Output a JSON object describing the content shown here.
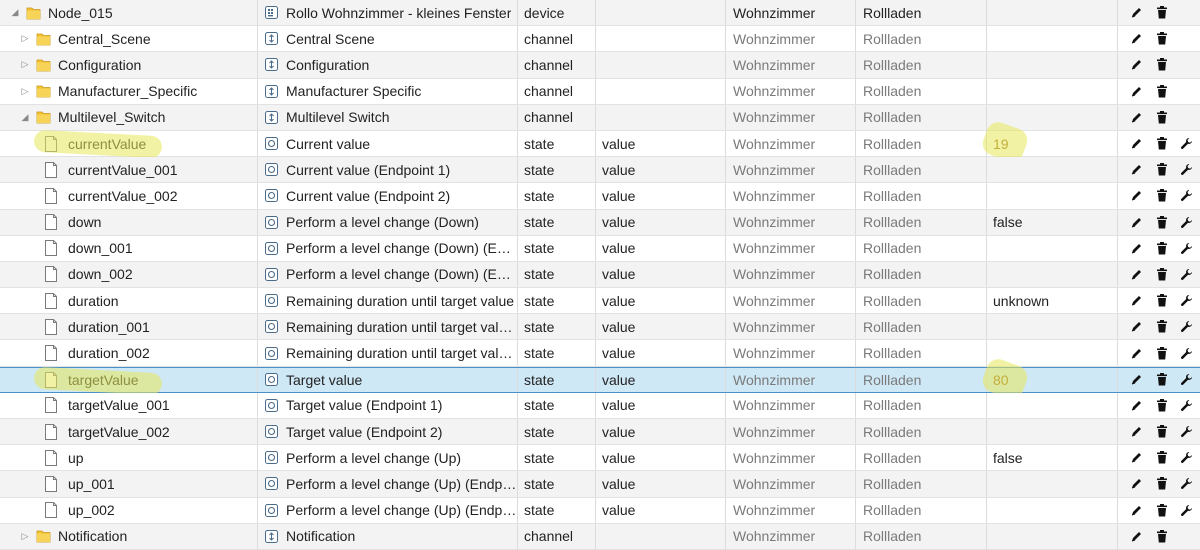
{
  "rows": [
    {
      "name": "Node_015",
      "desc": "Rollo Wohnzimmer - kleines Fenster",
      "type": "device",
      "role": "",
      "room": "Wohnzimmer",
      "func": "Rollladen",
      "value": ""
    },
    {
      "name": "Central_Scene",
      "desc": "Central Scene",
      "type": "channel",
      "role": "",
      "room": "Wohnzimmer",
      "func": "Rollladen",
      "value": ""
    },
    {
      "name": "Configuration",
      "desc": "Configuration",
      "type": "channel",
      "role": "",
      "room": "Wohnzimmer",
      "func": "Rollladen",
      "value": ""
    },
    {
      "name": "Manufacturer_Specific",
      "desc": "Manufacturer Specific",
      "type": "channel",
      "role": "",
      "room": "Wohnzimmer",
      "func": "Rollladen",
      "value": ""
    },
    {
      "name": "Multilevel_Switch",
      "desc": "Multilevel Switch",
      "type": "channel",
      "role": "",
      "room": "Wohnzimmer",
      "func": "Rollladen",
      "value": ""
    },
    {
      "name": "currentValue",
      "desc": "Current value",
      "type": "state",
      "role": "value",
      "room": "Wohnzimmer",
      "func": "Rollladen",
      "value": "19"
    },
    {
      "name": "currentValue_001",
      "desc": "Current value (Endpoint 1)",
      "type": "state",
      "role": "value",
      "room": "Wohnzimmer",
      "func": "Rollladen",
      "value": ""
    },
    {
      "name": "currentValue_002",
      "desc": "Current value (Endpoint 2)",
      "type": "state",
      "role": "value",
      "room": "Wohnzimmer",
      "func": "Rollladen",
      "value": ""
    },
    {
      "name": "down",
      "desc": "Perform a level change (Down)",
      "type": "state",
      "role": "value",
      "room": "Wohnzimmer",
      "func": "Rollladen",
      "value": "false"
    },
    {
      "name": "down_001",
      "desc": "Perform a level change (Down) (End...",
      "type": "state",
      "role": "value",
      "room": "Wohnzimmer",
      "func": "Rollladen",
      "value": ""
    },
    {
      "name": "down_002",
      "desc": "Perform a level change (Down) (End...",
      "type": "state",
      "role": "value",
      "room": "Wohnzimmer",
      "func": "Rollladen",
      "value": ""
    },
    {
      "name": "duration",
      "desc": "Remaining duration until target value",
      "type": "state",
      "role": "value",
      "room": "Wohnzimmer",
      "func": "Rollladen",
      "value": "unknown"
    },
    {
      "name": "duration_001",
      "desc": "Remaining duration until target valu...",
      "type": "state",
      "role": "value",
      "room": "Wohnzimmer",
      "func": "Rollladen",
      "value": ""
    },
    {
      "name": "duration_002",
      "desc": "Remaining duration until target valu...",
      "type": "state",
      "role": "value",
      "room": "Wohnzimmer",
      "func": "Rollladen",
      "value": ""
    },
    {
      "name": "targetValue",
      "desc": "Target value",
      "type": "state",
      "role": "value",
      "room": "Wohnzimmer",
      "func": "Rollladen",
      "value": "80"
    },
    {
      "name": "targetValue_001",
      "desc": "Target value (Endpoint 1)",
      "type": "state",
      "role": "value",
      "room": "Wohnzimmer",
      "func": "Rollladen",
      "value": ""
    },
    {
      "name": "targetValue_002",
      "desc": "Target value (Endpoint 2)",
      "type": "state",
      "role": "value",
      "room": "Wohnzimmer",
      "func": "Rollladen",
      "value": ""
    },
    {
      "name": "up",
      "desc": "Perform a level change (Up)",
      "type": "state",
      "role": "value",
      "room": "Wohnzimmer",
      "func": "Rollladen",
      "value": "false"
    },
    {
      "name": "up_001",
      "desc": "Perform a level change (Up) (Endpoi...",
      "type": "state",
      "role": "value",
      "room": "Wohnzimmer",
      "func": "Rollladen",
      "value": ""
    },
    {
      "name": "up_002",
      "desc": "Perform a level change (Up) (Endpoi...",
      "type": "state",
      "role": "value",
      "room": "Wohnzimmer",
      "func": "Rollladen",
      "value": ""
    },
    {
      "name": "Notification",
      "desc": "Notification",
      "type": "channel",
      "role": "",
      "room": "Wohnzimmer",
      "func": "Rollladen",
      "value": ""
    }
  ],
  "row_meta": [
    {
      "kind": "device",
      "expanded": true,
      "icon": "folder-icon",
      "desc_icon": "device-icon",
      "actions": [
        "edit-icon",
        "delete-icon"
      ]
    },
    {
      "kind": "channel",
      "expanded": false,
      "icon": "folder-icon",
      "desc_icon": "channel-icon",
      "actions": [
        "edit-icon",
        "delete-icon"
      ]
    },
    {
      "kind": "channel",
      "expanded": false,
      "icon": "folder-icon",
      "desc_icon": "channel-icon",
      "actions": [
        "edit-icon",
        "delete-icon"
      ]
    },
    {
      "kind": "channel",
      "expanded": false,
      "icon": "folder-icon",
      "desc_icon": "channel-icon",
      "actions": [
        "edit-icon",
        "delete-icon"
      ]
    },
    {
      "kind": "channel",
      "expanded": true,
      "icon": "folder-icon",
      "desc_icon": "channel-icon",
      "actions": [
        "edit-icon",
        "delete-icon"
      ]
    },
    {
      "kind": "state",
      "icon": "file-icon",
      "desc_icon": "state-icon",
      "actions": [
        "edit-icon",
        "delete-icon",
        "wrench-icon"
      ],
      "highlight": true
    },
    {
      "kind": "state",
      "icon": "file-icon",
      "desc_icon": "state-icon",
      "actions": [
        "edit-icon",
        "delete-icon",
        "wrench-icon"
      ]
    },
    {
      "kind": "state",
      "icon": "file-icon",
      "desc_icon": "state-icon",
      "actions": [
        "edit-icon",
        "delete-icon",
        "wrench-icon"
      ]
    },
    {
      "kind": "state",
      "icon": "file-icon",
      "desc_icon": "state-icon",
      "actions": [
        "edit-icon",
        "delete-icon",
        "wrench-icon"
      ]
    },
    {
      "kind": "state",
      "icon": "file-icon",
      "desc_icon": "state-icon",
      "actions": [
        "edit-icon",
        "delete-icon",
        "wrench-icon"
      ]
    },
    {
      "kind": "state",
      "icon": "file-icon",
      "desc_icon": "state-icon",
      "actions": [
        "edit-icon",
        "delete-icon",
        "wrench-icon"
      ]
    },
    {
      "kind": "state",
      "icon": "file-icon",
      "desc_icon": "state-icon",
      "actions": [
        "edit-icon",
        "delete-icon",
        "wrench-icon"
      ]
    },
    {
      "kind": "state",
      "icon": "file-icon",
      "desc_icon": "state-icon",
      "actions": [
        "edit-icon",
        "delete-icon",
        "wrench-icon"
      ]
    },
    {
      "kind": "state",
      "icon": "file-icon",
      "desc_icon": "state-icon",
      "actions": [
        "edit-icon",
        "delete-icon",
        "wrench-icon"
      ]
    },
    {
      "kind": "state",
      "icon": "file-icon",
      "desc_icon": "state-icon",
      "actions": [
        "edit-icon",
        "delete-icon",
        "wrench-icon"
      ],
      "selected": true,
      "highlight": true
    },
    {
      "kind": "state",
      "icon": "file-icon",
      "desc_icon": "state-icon",
      "actions": [
        "edit-icon",
        "delete-icon",
        "wrench-icon"
      ]
    },
    {
      "kind": "state",
      "icon": "file-icon",
      "desc_icon": "state-icon",
      "actions": [
        "edit-icon",
        "delete-icon",
        "wrench-icon"
      ]
    },
    {
      "kind": "state",
      "icon": "file-icon",
      "desc_icon": "state-icon",
      "actions": [
        "edit-icon",
        "delete-icon",
        "wrench-icon"
      ]
    },
    {
      "kind": "state",
      "icon": "file-icon",
      "desc_icon": "state-icon",
      "actions": [
        "edit-icon",
        "delete-icon",
        "wrench-icon"
      ]
    },
    {
      "kind": "state",
      "icon": "file-icon",
      "desc_icon": "state-icon",
      "actions": [
        "edit-icon",
        "delete-icon",
        "wrench-icon"
      ]
    },
    {
      "kind": "channel",
      "expanded": false,
      "icon": "folder-icon",
      "desc_icon": "channel-icon",
      "actions": [
        "edit-icon",
        "delete-icon"
      ]
    }
  ],
  "colors": {
    "selected_bg": "#cfe8f6",
    "selected_border": "#4a90c8",
    "highlight_marker": "#e8e85a",
    "folder": "#f2c230",
    "muted_text": "#7a7a7a",
    "highlight_value": "#9a6a1a"
  }
}
